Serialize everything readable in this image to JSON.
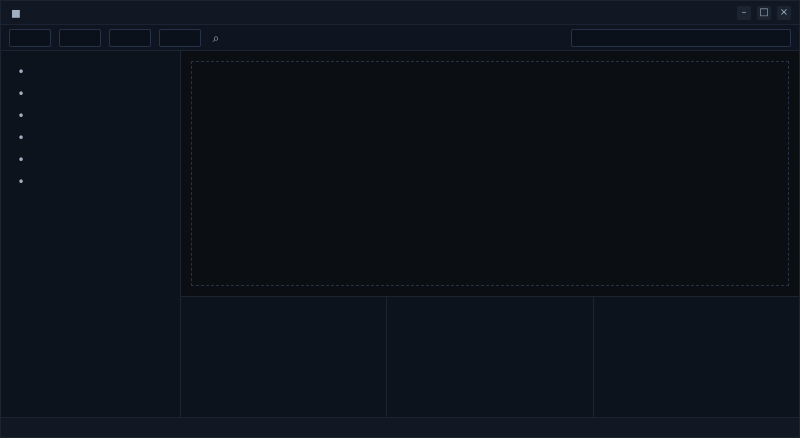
{
  "window": {
    "title": ""
  },
  "toolbar": {
    "buttons": [
      {
        "label": ""
      },
      {
        "label": ""
      },
      {
        "label": ""
      },
      {
        "label": ""
      }
    ],
    "search": {
      "value": "",
      "placeholder": ""
    }
  },
  "sidebar": {
    "title": "",
    "items": [
      {
        "label": ""
      },
      {
        "label": ""
      },
      {
        "label": ""
      },
      {
        "label": ""
      },
      {
        "label": ""
      },
      {
        "label": ""
      }
    ]
  },
  "panels": [
    {
      "title": ""
    },
    {
      "title": ""
    },
    {
      "title": ""
    }
  ],
  "status": {
    "text": ""
  },
  "chart_data": []
}
